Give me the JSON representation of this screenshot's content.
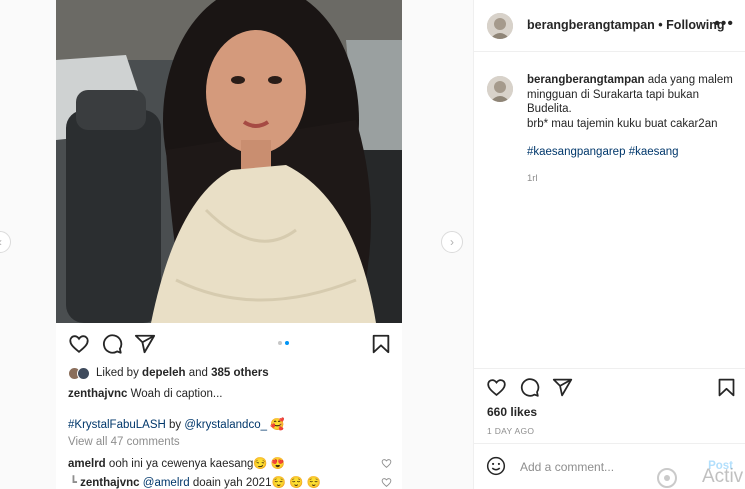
{
  "left_post": {
    "likes_prefix": "Liked by",
    "liked_user": "depeleh",
    "likes_and": "and",
    "likes_others": "385 others",
    "caption_user": "zenthajvnc",
    "caption_text": "Woah di caption...",
    "tag_line_hashtag": "#KrystalFabuLASH",
    "tag_line_by": "by",
    "tag_line_mention": "@krystalandco_",
    "tag_line_emoji": "🥰",
    "view_all": "View all 47 comments",
    "comment1_user": "amelrd",
    "comment1_text": "ooh ini ya cewenya kaesang😏 😍",
    "comment2_user": "zenthajvnc",
    "comment2_mention": "@amelrd",
    "comment2_text": "doain yah 2021😌 😌 😌"
  },
  "right_panel": {
    "header_username": "berangberangtampan",
    "header_sep": "•",
    "follow_state": "Following",
    "more_label": "•••",
    "caption_username": "berangberangtampan",
    "caption_line1": "ada yang malem mingguan di Surakarta tapi bukan Budelita.",
    "caption_line2": "brb* mau tajemin kuku buat cakar2an",
    "hashtag1": "#kaesangpangarep",
    "hashtag2": "#kaesang",
    "caption_age": "1rl",
    "likes": "660 likes",
    "date": "1 DAY AGO",
    "comment_placeholder": "Add a comment...",
    "post_label": "Post"
  },
  "watermark": "Activ",
  "icons": {
    "like": "heart-icon",
    "comment": "comment-icon",
    "share": "share-icon",
    "save": "bookmark-icon",
    "emoji": "smile-icon"
  },
  "colors": {
    "link": "#00376b",
    "accent": "#0095f6",
    "post_disabled": "#b2dffc",
    "muted": "#8e8e8e"
  }
}
